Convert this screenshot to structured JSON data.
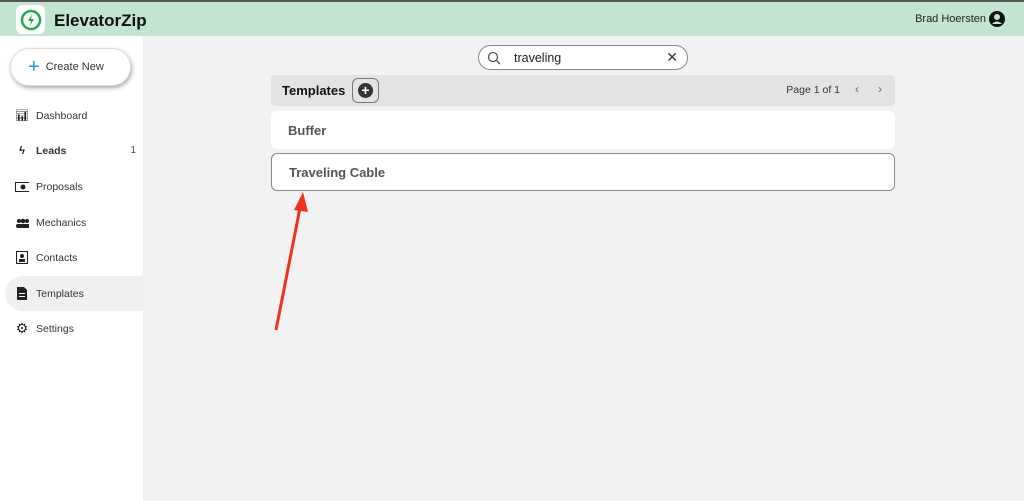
{
  "app": {
    "name": "ElevatorZip",
    "user": "Brad Hoersten",
    "accent": "#c3e4d1",
    "logo_color": "#1faa4f"
  },
  "sidebar": {
    "create_label": "Create New",
    "items": [
      {
        "label": "Dashboard",
        "icon": "bar-chart-icon"
      },
      {
        "label": "Leads",
        "icon": "bolt-icon",
        "count": "1",
        "bold": true
      },
      {
        "label": "Proposals",
        "icon": "money-icon"
      },
      {
        "label": "Mechanics",
        "icon": "users-icon"
      },
      {
        "label": "Contacts",
        "icon": "contact-card-icon"
      },
      {
        "label": "Templates",
        "icon": "document-icon",
        "active": true
      },
      {
        "label": "Settings",
        "icon": "gear-icon"
      }
    ]
  },
  "search": {
    "value": "traveling"
  },
  "templates": {
    "title": "Templates",
    "pagination": "Page 1 of 1",
    "rows": [
      {
        "name": "Buffer"
      },
      {
        "name": "Traveling Cable",
        "selected": true
      }
    ]
  },
  "annotation": {
    "arrow_color": "#f0321e"
  }
}
